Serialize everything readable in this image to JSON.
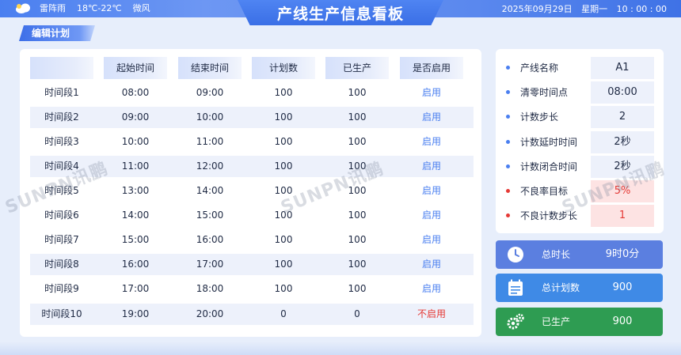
{
  "header": {
    "title": "产线生产信息看板",
    "weather": {
      "icon": "cloud-icon",
      "condition": "雷阵雨",
      "temperature": "18℃-22℃",
      "wind": "微风"
    },
    "date": "2025年09月29日",
    "weekday": "星期一",
    "time": "10 : 00 : 00"
  },
  "edit_button": "编辑计划",
  "table": {
    "headers": [
      "",
      "起始时间",
      "结束时间",
      "计划数",
      "已生产",
      "是否启用"
    ],
    "rows": [
      {
        "name": "时间段1",
        "start": "08:00",
        "end": "09:00",
        "plan": "100",
        "done": "100",
        "enabled": "启用"
      },
      {
        "name": "时间段2",
        "start": "09:00",
        "end": "10:00",
        "plan": "100",
        "done": "100",
        "enabled": "启用"
      },
      {
        "name": "时间段3",
        "start": "10:00",
        "end": "11:00",
        "plan": "100",
        "done": "100",
        "enabled": "启用"
      },
      {
        "name": "时间段4",
        "start": "11:00",
        "end": "12:00",
        "plan": "100",
        "done": "100",
        "enabled": "启用"
      },
      {
        "name": "时间段5",
        "start": "13:00",
        "end": "14:00",
        "plan": "100",
        "done": "100",
        "enabled": "启用"
      },
      {
        "name": "时间段6",
        "start": "14:00",
        "end": "15:00",
        "plan": "100",
        "done": "100",
        "enabled": "启用"
      },
      {
        "name": "时间段7",
        "start": "15:00",
        "end": "16:00",
        "plan": "100",
        "done": "100",
        "enabled": "启用"
      },
      {
        "name": "时间段8",
        "start": "16:00",
        "end": "17:00",
        "plan": "100",
        "done": "100",
        "enabled": "启用"
      },
      {
        "name": "时间段9",
        "start": "17:00",
        "end": "18:00",
        "plan": "100",
        "done": "100",
        "enabled": "启用"
      },
      {
        "name": "时间段10",
        "start": "19:00",
        "end": "20:00",
        "plan": "0",
        "done": "0",
        "enabled": "不启用"
      }
    ]
  },
  "info": [
    {
      "label": "产线名称",
      "value": "A1",
      "alert": false
    },
    {
      "label": "清零时间点",
      "value": "08:00",
      "alert": false
    },
    {
      "label": "计数步长",
      "value": "2",
      "alert": false
    },
    {
      "label": "计数延时时间",
      "value": "2秒",
      "alert": false
    },
    {
      "label": "计数闭合时间",
      "value": "2秒",
      "alert": false
    },
    {
      "label": "不良率目标",
      "value": "5%",
      "alert": true
    },
    {
      "label": "不良计数步长",
      "value": "1",
      "alert": true
    }
  ],
  "stats": {
    "total_duration": {
      "label": "总时长",
      "value": "9时0分",
      "icon": "clock-icon",
      "color": "#5b7fe0"
    },
    "total_plan": {
      "label": "总计划数",
      "value": "900",
      "icon": "calendar-icon",
      "color": "#3f8ae6"
    },
    "produced": {
      "label": "已生产",
      "value": "900",
      "icon": "gears-icon",
      "color": "#2e9c52"
    }
  },
  "watermark": "SUNPN讯鹏",
  "colors": {
    "accent": "#4a7ff0",
    "alert": "#e53935",
    "enabled": "#4a7ff0"
  }
}
